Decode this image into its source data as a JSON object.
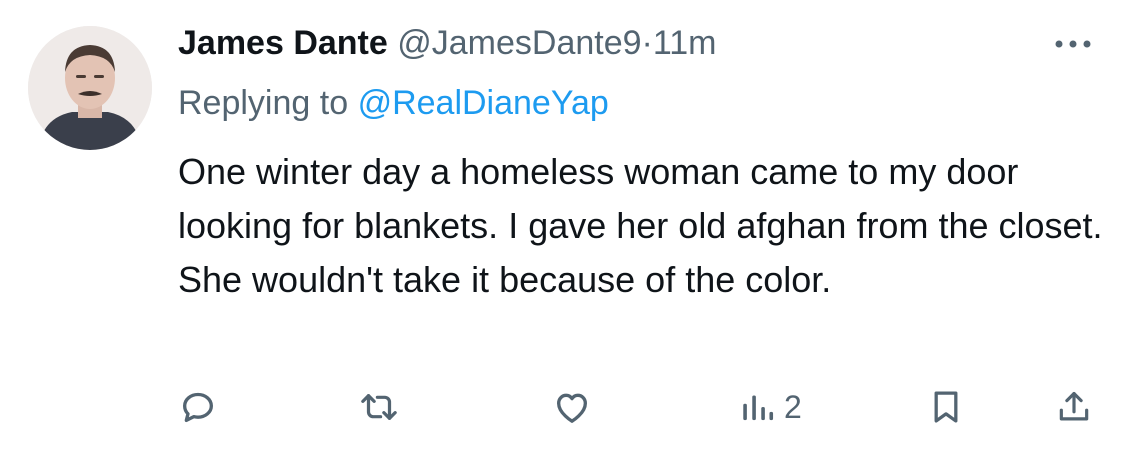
{
  "tweet": {
    "author_name": "James Dante",
    "handle": "@JamesDante9",
    "separator": "·",
    "time": "11m",
    "replying_prefix": "Replying to",
    "replying_handle": "@RealDianeYap",
    "text": "One winter day a homeless woman came to my door looking for blankets. I gave her old afghan from the closet. She wouldn't take it because of the color.",
    "views_count": "2"
  },
  "icons": {
    "more": "more-horizontal-icon",
    "reply": "reply-icon",
    "retweet": "retweet-icon",
    "like": "heart-icon",
    "views": "views-icon",
    "bookmark": "bookmark-icon",
    "share": "share-icon"
  },
  "colors": {
    "text": "#0f1419",
    "secondary": "#536471",
    "accent": "#1d9bf0"
  }
}
